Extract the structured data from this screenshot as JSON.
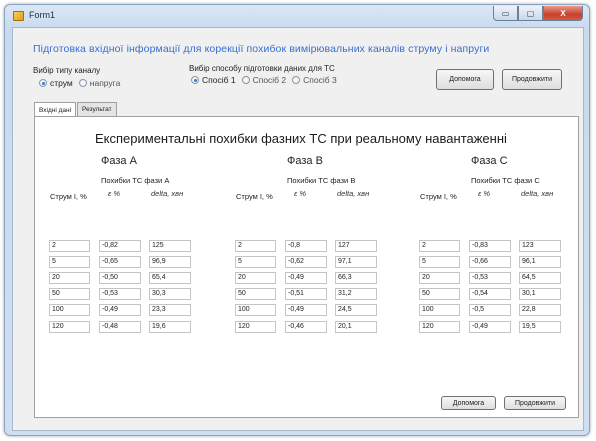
{
  "window": {
    "title": "Form1",
    "controls": {
      "minimize": "▭",
      "maximize": "▢",
      "close": "X"
    }
  },
  "header": {
    "title": "Підготовка вхідної інформації для корекції похибок вимірювальних каналів струму і напруги"
  },
  "channel_type": {
    "label": "Вибір типу каналу",
    "options": [
      {
        "label": "струм",
        "checked": true
      },
      {
        "label": "напруга",
        "checked": false
      }
    ]
  },
  "prep_method": {
    "label": "Вибір способу підготовки даних для ТС",
    "options": [
      {
        "label": "Спосіб 1",
        "checked": true
      },
      {
        "label": "Спосіб 2",
        "checked": false
      },
      {
        "label": "Спосіб 3",
        "checked": false
      }
    ]
  },
  "top_buttons": {
    "help": "Допомога",
    "continue": "Продовжити"
  },
  "tabs": [
    {
      "label": "Вхідні дані",
      "active": true
    },
    {
      "label": "Результат",
      "active": false
    }
  ],
  "panel": {
    "heading": "Експериментальні похибки фазних ТС при реальному навантаженні",
    "phases": [
      {
        "title": "Фаза А",
        "current_header": "Струм I, %",
        "error_header": "Похибки ТС фази А",
        "sub_eps": "ε %",
        "sub_delta": "delta, хвн",
        "rows": [
          [
            "2",
            "-0,82",
            "125"
          ],
          [
            "5",
            "-0,65",
            "96,9"
          ],
          [
            "20",
            "-0,50",
            "65,4"
          ],
          [
            "50",
            "-0,53",
            "30,3"
          ],
          [
            "100",
            "-0,49",
            "23,3"
          ],
          [
            "120",
            "-0,48",
            "19,6"
          ]
        ]
      },
      {
        "title": "Фаза В",
        "current_header": "Струм I, %",
        "error_header": "Похибки ТС фази В",
        "sub_eps": "ε %",
        "sub_delta": "delta, хвн",
        "rows": [
          [
            "2",
            "-0,8",
            "127"
          ],
          [
            "5",
            "-0,62",
            "97,1"
          ],
          [
            "20",
            "-0,49",
            "66,3"
          ],
          [
            "50",
            "-0,51",
            "31,2"
          ],
          [
            "100",
            "-0,49",
            "24,5"
          ],
          [
            "120",
            "-0,46",
            "20,1"
          ]
        ]
      },
      {
        "title": "Фаза С",
        "current_header": "Струм I, %",
        "error_header": "Похибки ТС фази С",
        "sub_eps": "ε %",
        "sub_delta": "delta, хвн",
        "rows": [
          [
            "2",
            "-0,83",
            "123"
          ],
          [
            "5",
            "-0,66",
            "96,1"
          ],
          [
            "20",
            "-0,53",
            "64,5"
          ],
          [
            "50",
            "-0,54",
            "30,1"
          ],
          [
            "100",
            "-0,5",
            "22,8"
          ],
          [
            "120",
            "-0,49",
            "19,5"
          ]
        ]
      }
    ]
  },
  "bottom_buttons": {
    "help": "Допомога",
    "continue": "Продовжити"
  }
}
